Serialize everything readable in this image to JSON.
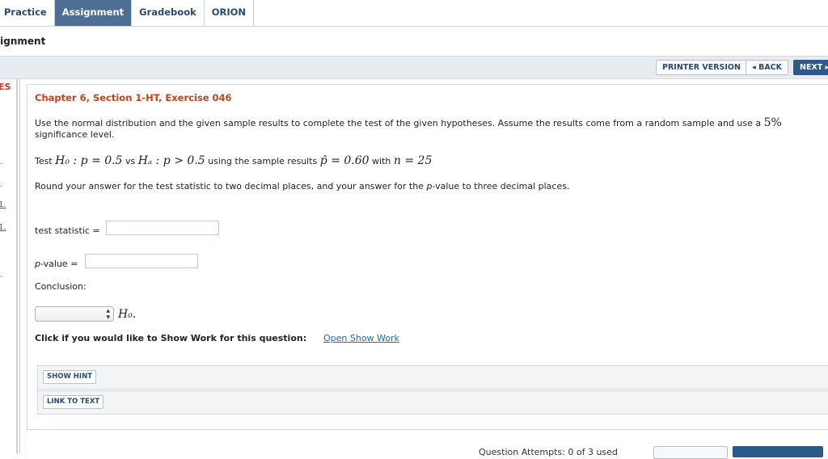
{
  "tabs": [
    {
      "label": "Practice",
      "active": false
    },
    {
      "label": "Assignment",
      "active": true
    },
    {
      "label": "Gradebook",
      "active": false
    },
    {
      "label": "ORION",
      "active": false
    }
  ],
  "page_title": "signment",
  "toolbar": {
    "printer_version": "PRINTER VERSION",
    "back": "◂ BACK",
    "next": "NEXT ▸"
  },
  "sidebar": {
    "heading_fragment": "ES",
    "links": [
      "1.",
      "1."
    ],
    "dots": [
      ".",
      ".",
      ".",
      "."
    ]
  },
  "exercise": {
    "title": "Chapter 6, Section 1-HT, Exercise 046",
    "instructions": "Use the normal distribution and the given sample results to complete the test of the given hypotheses. Assume the results come from a random sample and use a",
    "significance_value": "5%",
    "instructions_end": "significance level.",
    "test_prefix": "Test",
    "h0_expr": "H₀ : p = 0.5",
    "vs": "vs",
    "ha_expr": "Hₐ : p > 0.5",
    "using_text": "using the sample results",
    "phat_expr": "p̂ = 0.60",
    "with_text": "with",
    "n_expr": "n = 25",
    "round_text_1": "Round your answer for the test statistic to two decimal places, and your answer for the",
    "round_p": "p",
    "round_text_2": "-value to three decimal places.",
    "test_statistic_label": "test statistic =",
    "test_statistic_value": "",
    "pvalue_label_p": "p",
    "pvalue_label_rest": "-value =",
    "pvalue_value": "",
    "conclusion_label": "Conclusion:",
    "conclusion_selected": "",
    "conclusion_suffix": "H₀."
  },
  "show_work": {
    "question": "Click if you would like to Show Work for this question:",
    "link": "Open Show Work"
  },
  "hint_buttons": {
    "show_hint": "SHOW HINT",
    "link_to_text": "LINK TO TEXT"
  },
  "footer": {
    "attempts_text": "Question Attempts: 0 of 3 used"
  },
  "colors": {
    "tab_active_bg": "#4d6f94",
    "chapter_title": "#c0421b",
    "link": "#2a64a8",
    "next_button": "#2d5a87"
  }
}
